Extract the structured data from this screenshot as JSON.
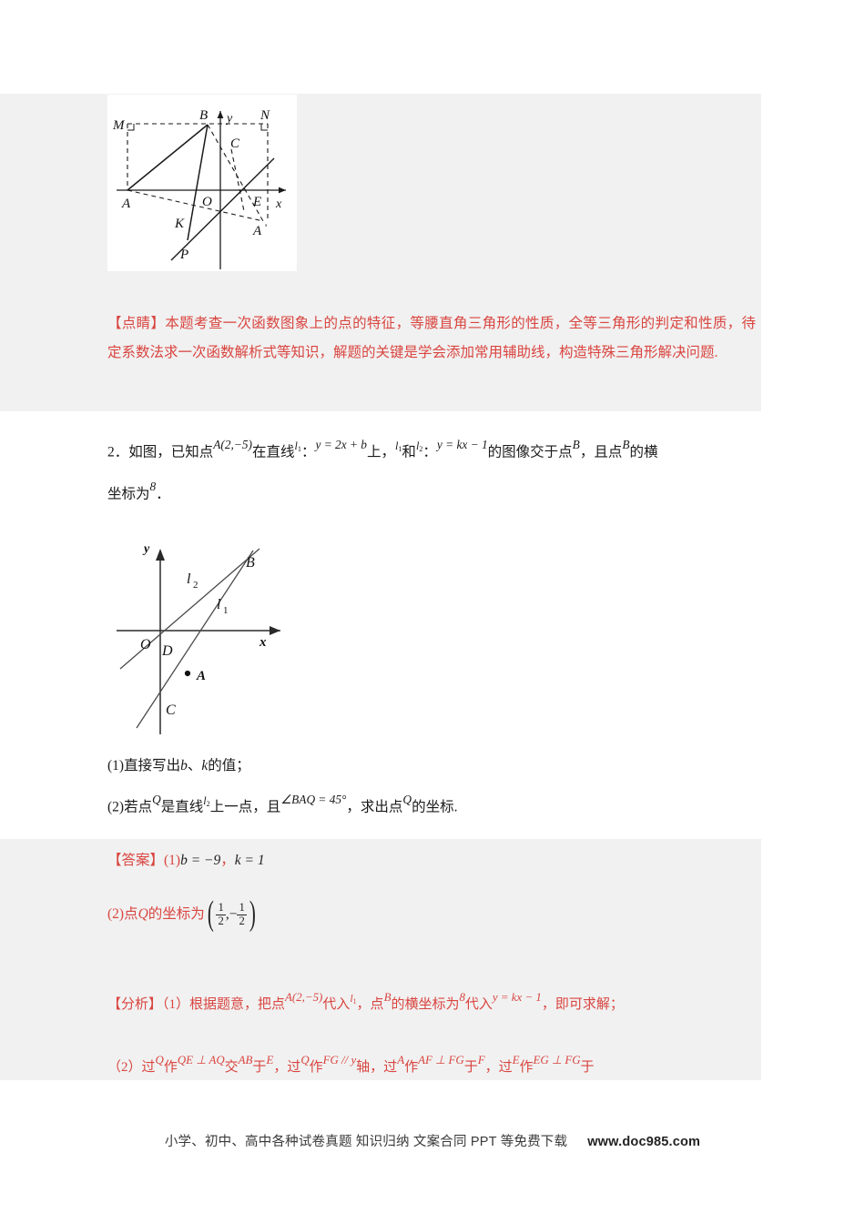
{
  "document": {
    "figure1": {
      "caption": "geometry-figure-isosceles-right-triangle",
      "labels": [
        "M",
        "B",
        "y",
        "N",
        "C",
        "A",
        "O",
        "E",
        "x",
        "K",
        "A'",
        "P"
      ]
    },
    "tips": {
      "marker": "【点睛】",
      "text": "本题考查一次函数图象上的点的特征，等腰直角三角形的性质，全等三角形的判定和性质，待定系数法求一次函数解析式等知识，解题的关键是学会添加常用辅助线，构造特殊三角形解决问题."
    },
    "question2": {
      "number": "2",
      "lead": "．如图，已知点",
      "pointA": "A(2,−5)",
      "mid1": "在直线",
      "l1": "l",
      "l1sub": "1",
      "colon": "：",
      "eq1": "y = 2x + b",
      "mid2": "上，",
      "l1b": "l",
      "l1bsub": "1",
      "he": "和",
      "l2": "l",
      "l2sub": "2",
      "colon2": "：",
      "eq2": "y = kx − 1",
      "mid3": "的图像交于点",
      "pointB": "B",
      "mid4": "，且点",
      "pointB2": "B",
      "mid5": "的横",
      "line2a": "坐标为",
      "eight": "8",
      "line2b": "．"
    },
    "figure2": {
      "caption": "coordinate-figure-two-lines",
      "labels": [
        "y",
        "B",
        "l2",
        "l1",
        "O",
        "D",
        "x",
        "A",
        "C"
      ]
    },
    "subquestions": {
      "q1_pre": "(1)直接写出",
      "q1_b": "b",
      "q1_mid": "、",
      "q1_k": "k",
      "q1_post": "的值；",
      "q2_pre": "(2)若点",
      "q2_Q": "Q",
      "q2_a": "是直线",
      "q2_l2": "l",
      "q2_l2sub": "2",
      "q2_b": "上一点，且",
      "q2_angle": "∠BAQ = 45°",
      "q2_c": "，求出点",
      "q2_Q2": "Q",
      "q2_d": "的坐标."
    },
    "answer": {
      "marker": "【答案】",
      "num1": "(1)",
      "b_eq": "b = −9",
      "comma": "，",
      "k_eq": "k = 1",
      "num2": "(2)",
      "q_pre": "点",
      "q_Q": "Q",
      "q_post": "的坐标为",
      "coord": {
        "x_num": "1",
        "x_den": "2",
        "sep": ",",
        "y_sign": "−",
        "y_num": "1",
        "y_den": "2"
      }
    },
    "analysis": {
      "marker": "【分析】",
      "line1": {
        "a": "（1）根据题意，把点",
        "pointA": "A(2,−5)",
        "b": "代入",
        "l1": "l",
        "l1sub": "1",
        "c": "，点",
        "pointB": "B",
        "d": "的横坐标为",
        "eight": "8",
        "e": "代入",
        "eq": "y = kx − 1",
        "f": "，即可求解；"
      },
      "line2": {
        "a": "（2）过",
        "Q1": "Q",
        "b": "作",
        "perp1": "QE ⊥ AQ",
        "c": "交",
        "AB": "AB",
        "d": "于",
        "E1": "E",
        "e": "，过",
        "Q2": "Q",
        "f": "作",
        "FG": "FG // y",
        "g": "轴，过",
        "A1": "A",
        "h": "作",
        "perp2": "AF ⊥ FG",
        "i": "于",
        "F1": "F",
        "j": "，过",
        "E2": "E",
        "k": "作",
        "perp3": "EG ⊥ FG",
        "l": "于"
      }
    },
    "footer": {
      "text": "小学、初中、高中各种试卷真题 知识归纳 文案合同 PPT 等免费下载",
      "url": "www.doc985.com"
    }
  }
}
